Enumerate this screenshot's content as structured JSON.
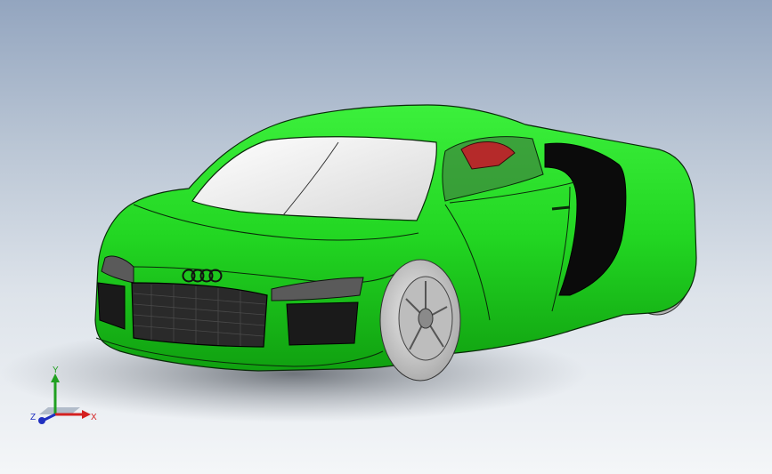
{
  "viewport": {
    "background_top": "#93a5bf",
    "background_bottom": "#f4f6f8"
  },
  "model": {
    "body_color": "#22d622",
    "body_shade_color": "#14a814",
    "window_color": "#f2f2f2",
    "grille_color": "#2a2a2a",
    "side_intake_color": "#0d0d0d",
    "interior_seat_color": "#b52a2a",
    "wheel_color": "#c8c8c8",
    "edge_color": "#0a2a0a"
  },
  "triad": {
    "x_label": "X",
    "y_label": "Y",
    "z_label": "Z",
    "x_color": "#d42020",
    "y_color": "#20a020",
    "z_color": "#2030c0"
  }
}
